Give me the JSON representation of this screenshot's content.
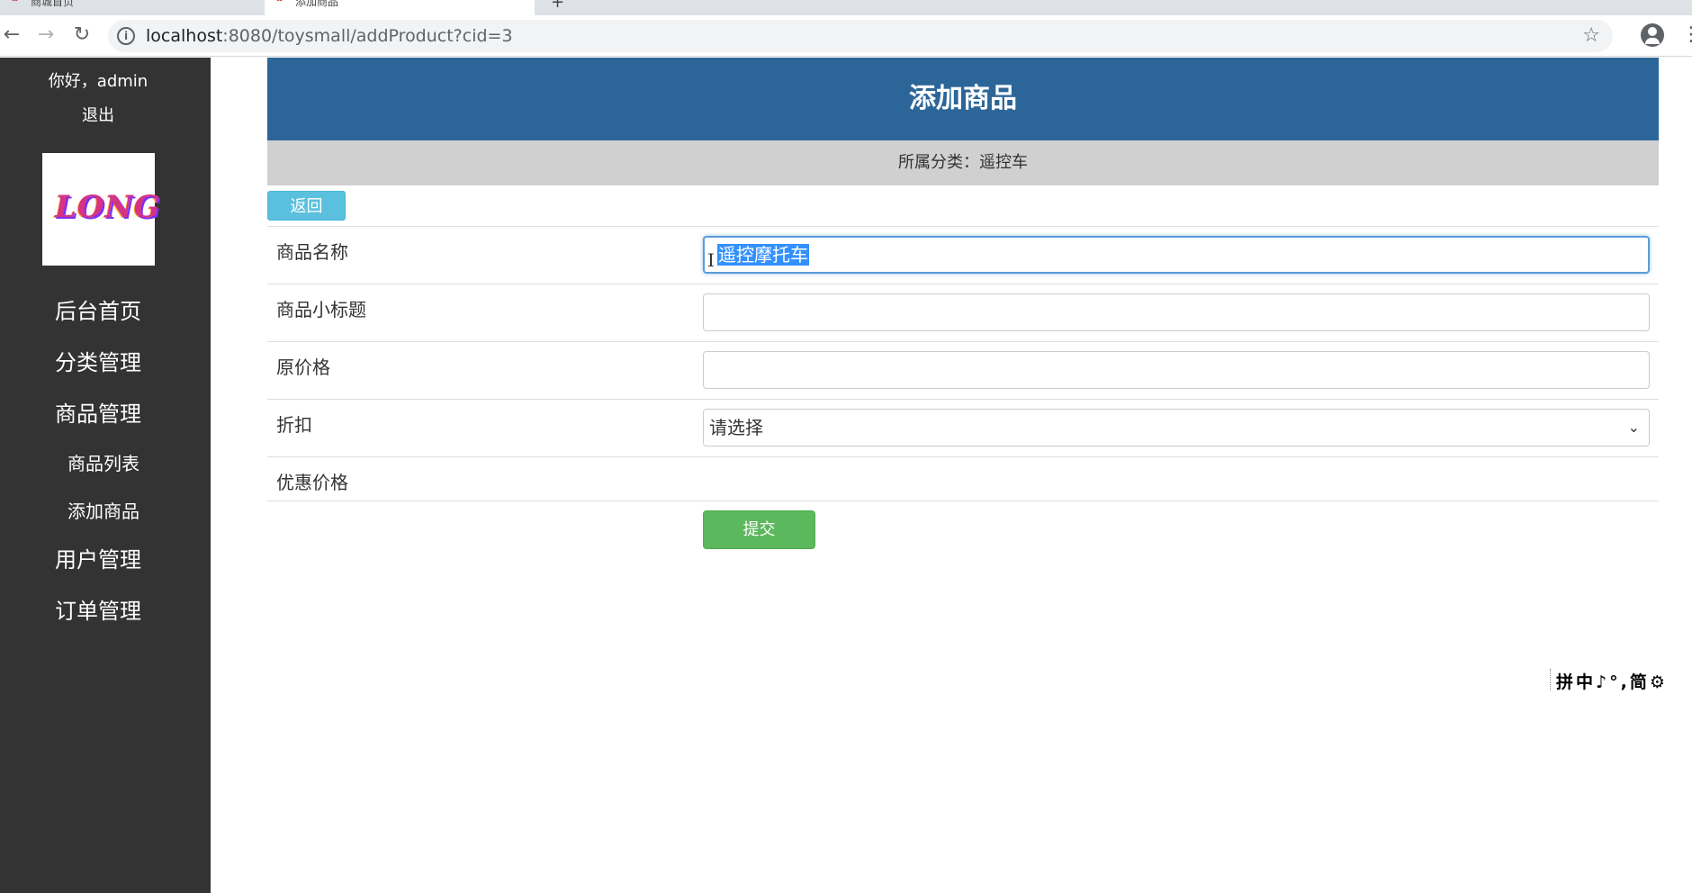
{
  "browser": {
    "tabs": [
      {
        "title": "商城首页",
        "active": false
      },
      {
        "title": "添加商品",
        "active": true
      }
    ],
    "new_tab": "+",
    "url_host": "localhost",
    "url_rest": ":8080/toysmall/addProduct?cid=3"
  },
  "sidebar": {
    "greeting": "你好，admin",
    "logout": "退出",
    "logo_text": "LONG",
    "menu": {
      "home": "后台首页",
      "category": "分类管理",
      "product": "商品管理",
      "product_list": "商品列表",
      "add_product": "添加商品",
      "user": "用户管理",
      "order": "订单管理"
    }
  },
  "main": {
    "title": "添加商品",
    "category_line": "所属分类：遥控车",
    "back_label": "返回",
    "fields": {
      "name_label": "商品名称",
      "name_value": "遥控摩托车",
      "subtitle_label": "商品小标题",
      "subtitle_value": "",
      "price_label": "原价格",
      "price_value": "",
      "discount_label": "折扣",
      "discount_selected": "请选择",
      "sale_price_label": "优惠价格"
    },
    "submit_label": "提交"
  },
  "ime_bar": "拼中♪°,简⚙",
  "colors": {
    "sidebar_bg": "#333333",
    "banner_bg": "#2c6699",
    "back_button": "#5bc0de",
    "submit_button": "#5cb85c"
  }
}
